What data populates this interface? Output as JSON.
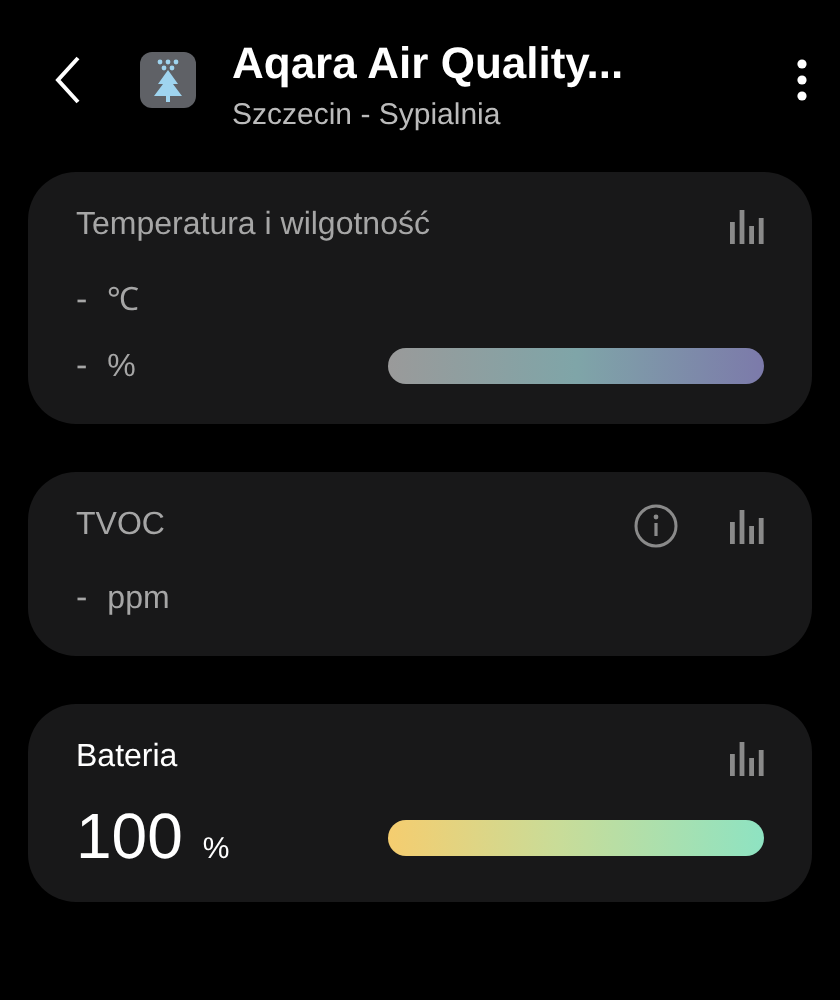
{
  "header": {
    "title": "Aqara Air Quality...",
    "subtitle": "Szczecin - Sypialnia"
  },
  "cards": [
    {
      "title": "Temperatura i wilgotność",
      "disabled": true,
      "info": false,
      "readings": [
        {
          "value": "-",
          "unit": "℃",
          "kind": "plain"
        },
        {
          "value": "-",
          "unit": "%",
          "kind": "humidity"
        }
      ]
    },
    {
      "title": "TVOC",
      "disabled": true,
      "info": true,
      "readings": [
        {
          "value": "-",
          "unit": "ppm",
          "kind": "plain"
        }
      ]
    },
    {
      "title": "Bateria",
      "disabled": false,
      "info": false,
      "readings": [
        {
          "value": "100",
          "unit": "%",
          "kind": "battery"
        }
      ]
    }
  ]
}
